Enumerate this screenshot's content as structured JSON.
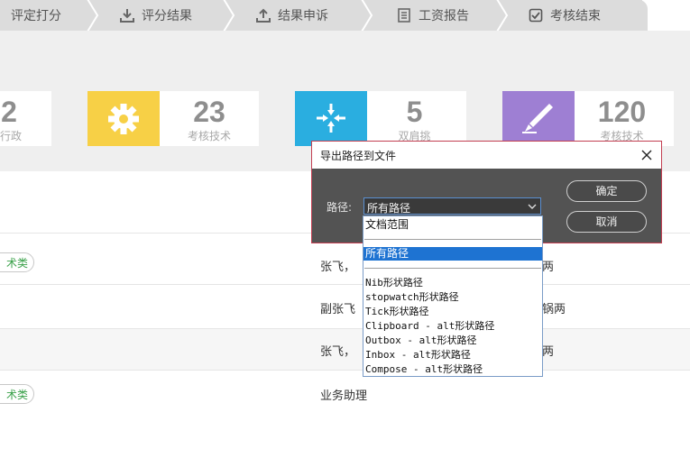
{
  "tabs": [
    {
      "label": "评定打分",
      "icon": "edit-icon"
    },
    {
      "label": "评分结果",
      "icon": "download-icon"
    },
    {
      "label": "结果申诉",
      "icon": "upload-icon"
    },
    {
      "label": "工资报告",
      "icon": "document-icon"
    },
    {
      "label": "考核结束",
      "icon": "checkbox-icon"
    }
  ],
  "stats": [
    {
      "value": "2",
      "label": "行政",
      "color": "#ffffff"
    },
    {
      "value": "23",
      "label": "考核技术",
      "color": "#f7d046",
      "icon": "gear-icon"
    },
    {
      "value": "5",
      "label": "双肩挑",
      "color": "#2aaee0",
      "icon": "collapse-arrows-icon"
    },
    {
      "value": "120",
      "label": "考核技术",
      "color": "#9e7fd3",
      "icon": "brush-icon"
    }
  ],
  "rows": [
    {
      "tag": "术类",
      "name": "张飞，",
      "tail": "两"
    },
    {
      "tag": "",
      "name": "副张飞",
      "tail": "锅两"
    },
    {
      "tag": "",
      "name": "张飞，",
      "tail": "两"
    },
    {
      "tag": "术类",
      "name": "业务助理",
      "tail": ""
    }
  ],
  "dialog": {
    "title": "导出路径到文件",
    "path_label": "路径:",
    "selected": "所有路径",
    "ok": "确定",
    "cancel": "取消"
  },
  "dropdown": {
    "group1": "文档范围",
    "group2": "所有路径",
    "items": [
      "Nib形状路径",
      "stopwatch形状路径",
      "Tick形状路径",
      "Clipboard - alt形状路径",
      "Outbox - alt形状路径",
      "Inbox - alt形状路径",
      "Compose - alt形状路径"
    ]
  }
}
